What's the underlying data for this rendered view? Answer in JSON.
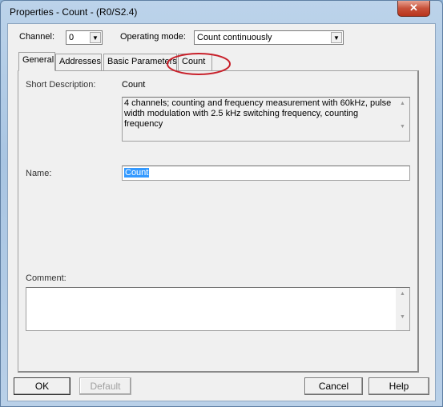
{
  "window": {
    "title": "Properties - Count - (R0/S2.4)",
    "close_icon": "close-icon"
  },
  "header": {
    "channel_label": "Channel:",
    "channel_value": "0",
    "mode_label": "Operating mode:",
    "mode_value": "Count continuously"
  },
  "tabs": [
    {
      "label": "General",
      "active": true
    },
    {
      "label": "Addresses"
    },
    {
      "label": "Basic Parameters"
    },
    {
      "label": "Count",
      "highlighted": true
    }
  ],
  "general": {
    "short_desc_label": "Short Description:",
    "short_desc_value": "Count",
    "description": "4 channels; counting and frequency measurement with 60kHz, pulse width modulation with 2.5 kHz switching frequency, counting frequency",
    "name_label": "Name:",
    "name_value": "Count",
    "comment_label": "Comment:",
    "comment_value": ""
  },
  "buttons": {
    "ok": "OK",
    "default": "Default",
    "cancel": "Cancel",
    "help": "Help"
  },
  "colors": {
    "highlight_circle": "#c8202a",
    "selection": "#3399ff"
  }
}
